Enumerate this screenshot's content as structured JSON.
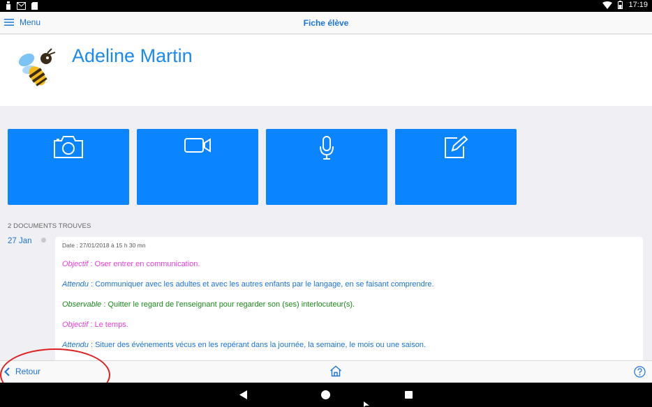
{
  "statusbar": {
    "time": "17:19"
  },
  "navbar": {
    "menu_label": "Menu",
    "title": "Fiche élève"
  },
  "student": {
    "name": "Adeline Martin"
  },
  "tiles": [
    {
      "icon": "camera-icon"
    },
    {
      "icon": "video-icon"
    },
    {
      "icon": "microphone-icon"
    },
    {
      "icon": "edit-note-icon"
    }
  ],
  "documents": {
    "count_label": "2 DOCUMENTS TROUVES",
    "entries": [
      {
        "day_label": "27 Jan",
        "date_text": "Date : 27/01/2018 à 15 h 30 mn",
        "lines": [
          {
            "key": "Objectif",
            "sep": " : ",
            "text": "Oser entrer en communication.",
            "type": "objectif"
          },
          {
            "key": "Attendu",
            "sep": " : ",
            "text": "Communiquer avec les adultes et avec les autres enfants par le langage, en se faisant comprendre.",
            "type": "attendu"
          },
          {
            "key": "Observable",
            "sep": " : ",
            "text": "Quitter le regard de l'enseignant pour regarder son (ses) interlocuteur(s).",
            "type": "observable"
          },
          {
            "key": "Objectif",
            "sep": " : ",
            "text": "Le temps.",
            "type": "objectif"
          },
          {
            "key": "Attendu",
            "sep": " : ",
            "text": "Situer des événements vécus en les repérant dans la journée, la semaine, le mois ou une saison.",
            "type": "attendu"
          }
        ]
      }
    ]
  },
  "bottombar": {
    "back_label": "Retour"
  },
  "colors": {
    "accent": "#1a73d9",
    "tile": "#0a84ff",
    "objectif": "#e83fd8",
    "attendu": "#1a73d9",
    "observable": "#1a8a1a",
    "annotation": "#e02020"
  }
}
